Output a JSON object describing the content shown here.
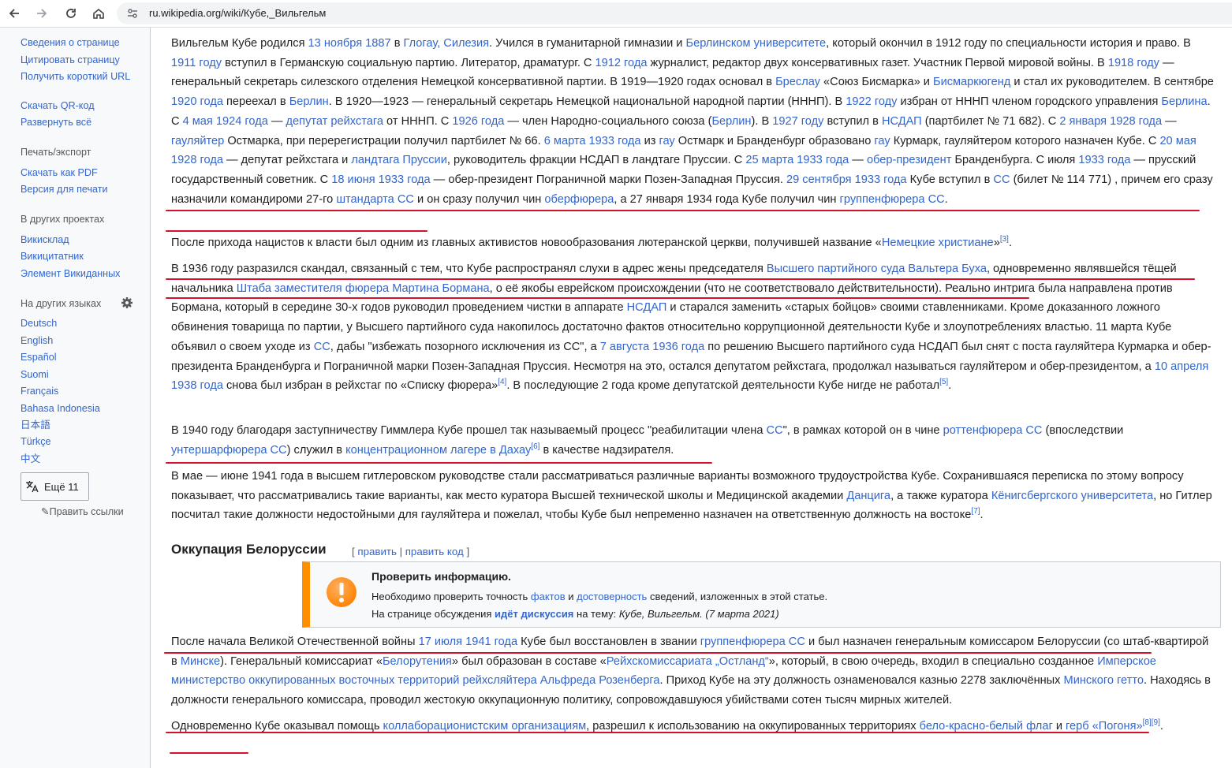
{
  "browser": {
    "url": "ru.wikipedia.org/wiki/Кубе,_Вильгельм"
  },
  "sidebar": {
    "tools": [
      "Сведения о странице",
      "Цитировать страницу",
      "Получить короткий URL",
      "Скачать QR-код",
      "Развернуть всё"
    ],
    "print_heading": "Печать/экспорт",
    "print_items": [
      "Скачать как PDF",
      "Версия для печати"
    ],
    "projects_heading": "В других проектах",
    "projects_items": [
      "Викисклад",
      "Викицитатник",
      "Элемент Викиданных"
    ],
    "languages_heading": "На других языках",
    "languages": [
      "Deutsch",
      "English",
      "Español",
      "Suomi",
      "Français",
      "Bahasa Indonesia",
      "日本語",
      "Türkçe",
      "中文"
    ],
    "more_label": "Ещё 11",
    "edit_links": "Править ссылки"
  },
  "article": {
    "p1": [
      {
        "t": "Вильгельм Кубе родился "
      },
      {
        "t": "13 ноября 1887",
        "l": 1
      },
      {
        "t": " в "
      },
      {
        "t": "Глогау, Силезия",
        "l": 1
      },
      {
        "t": ". Учился в гуманитарной гимназии и "
      },
      {
        "t": "Берлинском университете",
        "l": 1
      },
      {
        "t": ", который окончил в 1912 году по специальности история и право. В "
      },
      {
        "t": "1911 году",
        "l": 1
      },
      {
        "t": " вступил в Германскую социальную партию. Литератор, драматург. С "
      },
      {
        "t": "1912 года",
        "l": 1
      },
      {
        "t": " журналист, редактор двух консервативных газет. Участник Первой мировой войны. В "
      },
      {
        "t": "1918 году",
        "l": 1
      },
      {
        "t": " — генеральный секретарь силезского отделения Немецкой консервативной партии. В 1919—1920 годах основал в "
      },
      {
        "t": "Бреслау",
        "l": 1
      },
      {
        "t": " «Союз Бисмарка» и "
      },
      {
        "t": "Бисмаркюгенд",
        "l": 1
      },
      {
        "t": " и стал их руководителем. В сентябре "
      },
      {
        "t": "1920 года",
        "l": 1
      },
      {
        "t": " переехал в "
      },
      {
        "t": "Берлин",
        "l": 1
      },
      {
        "t": ". В 1920—1923 — генеральный секретарь Немецкой национальной народной партии (НННП). В "
      },
      {
        "t": "1922 году",
        "l": 1
      },
      {
        "t": " избран от НННП членом городского управления "
      },
      {
        "t": "Берлина",
        "l": 1
      },
      {
        "t": ". С "
      },
      {
        "t": "4 мая 1924 года",
        "l": 1
      },
      {
        "t": " — "
      },
      {
        "t": "депутат рейхстага",
        "l": 1
      },
      {
        "t": " от НННП. С "
      },
      {
        "t": "1926 года",
        "l": 1
      },
      {
        "t": " — член Народно-социального союза ("
      },
      {
        "t": "Берлин",
        "l": 1
      },
      {
        "t": "). В "
      },
      {
        "t": "1927 году",
        "l": 1
      },
      {
        "t": " вступил в "
      },
      {
        "t": "НСДАП",
        "l": 1
      },
      {
        "t": " (партбилет № 71 682). С "
      },
      {
        "t": "2 января 1928 года",
        "l": 1
      },
      {
        "t": " — "
      },
      {
        "t": "гауляйтер",
        "l": 1
      },
      {
        "t": " Остмарка, при перерегистрации получил партбилет № 66. "
      },
      {
        "t": "6 марта 1933 года",
        "l": 1
      },
      {
        "t": " из "
      },
      {
        "t": "гау",
        "l": 1
      },
      {
        "t": " Остмарк и Бранденбург образовано "
      },
      {
        "t": "гау",
        "l": 1
      },
      {
        "t": " Курмарк, гауляйтером которого назначен Кубе. С "
      },
      {
        "t": "20 мая 1928 года",
        "l": 1
      },
      {
        "t": " — депутат рейхстага и "
      },
      {
        "t": "ландтага Пруссии",
        "l": 1
      },
      {
        "t": ", руководитель фракции НСДАП в ландтаге Пруссии. С "
      },
      {
        "t": "25 марта 1933 года",
        "l": 1
      },
      {
        "t": " — "
      },
      {
        "t": "обер-президент",
        "l": 1
      },
      {
        "t": " Бранденбурга. С июля "
      },
      {
        "t": "1933 года",
        "l": 1
      },
      {
        "t": " — прусский государственный советник. С "
      },
      {
        "t": "18 июня 1933 года",
        "l": 1
      },
      {
        "t": " — обер-президент Пограничной марки Позен-Западная Пруссия. "
      },
      {
        "t": "29 сентября 1933 года",
        "l": 1
      },
      {
        "t": " Кубе вступил в "
      },
      {
        "t": "СС",
        "l": 1
      },
      {
        "t": " (билет № 114 771) , причем его сразу назначили командироми 27-го "
      },
      {
        "t": "штандарта СС",
        "l": 1
      },
      {
        "t": " и он сразу получил чин "
      },
      {
        "t": "оберфюрера",
        "l": 1
      },
      {
        "t": ", а 27 января 1934 года Кубе получил чин "
      },
      {
        "t": "группенфюрера СС",
        "l": 1
      },
      {
        "t": "."
      }
    ],
    "p2": [
      {
        "t": "После прихода нацистов к власти был одним из главных активистов новообразования лютеранской церкви, получившей название «"
      },
      {
        "t": "Немецкие христиане",
        "l": 1
      },
      {
        "t": "»"
      },
      {
        "t": "[3]",
        "s": 1
      },
      {
        "t": "."
      }
    ],
    "p3": [
      {
        "t": "В 1936 году разразился скандал, связанный с тем, что Кубе распространял слухи в адрес жены председателя "
      },
      {
        "t": "Высшего партийного суда",
        "l": 1
      },
      {
        "t": " "
      },
      {
        "t": "Вальтера Буха",
        "l": 1
      },
      {
        "t": ", одновременно являвшейся тёщей начальника "
      },
      {
        "t": "Штаба заместителя фюрера",
        "l": 1
      },
      {
        "t": " "
      },
      {
        "t": "Мартина Бормана",
        "l": 1
      },
      {
        "t": ", о её якобы еврейском происхождении (что не соответствовало действительности). Реально интрига была направлена против Бормана, который в середине 30-х годов руководил проведением чистки в аппарате "
      },
      {
        "t": "НСДАП",
        "l": 1
      },
      {
        "t": " и старался заменить «старых бойцов» своими ставленниками. Кроме доказанного ложного обвинения товарища по партии, у Высшего партийного суда накопилось достаточно фактов относительно коррупционной деятельности Кубе и злоупотреблениях властью. 11 марта Кубе объявил о своем уходе из "
      },
      {
        "t": "СС",
        "l": 1
      },
      {
        "t": ", дабы \"избежать позорного исключения из СС\", а "
      },
      {
        "t": "7 августа 1936 года",
        "l": 1
      },
      {
        "t": " по решению Высшего партийного суда НСДАП был снят с поста гауляйтера Курмарка и обер-президента Бранденбурга и Пограничной марки Позен-Западная Пруссия. Несмотря на это, остался депутатом рейхстага, продолжал называться гауляйтером и обер-президентом, а "
      },
      {
        "t": "10 апреля 1938 года",
        "l": 1
      },
      {
        "t": " снова был избран в рейхстаг по «Списку фюрера»"
      },
      {
        "t": "[4]",
        "s": 1
      },
      {
        "t": ". В последующие 2 года кроме депутатской деятельности Кубе нигде не работал"
      },
      {
        "t": "[5]",
        "s": 1
      },
      {
        "t": "."
      }
    ],
    "p4": [
      {
        "t": "В 1940 году благодаря заступничеству Гиммлера Кубе прошел так называемый процесс \"реабилитации члена "
      },
      {
        "t": "СС",
        "l": 1
      },
      {
        "t": "\", в рамках которой он в чине "
      },
      {
        "t": "роттенфюрера СС",
        "l": 1
      },
      {
        "t": " (впоследствии "
      },
      {
        "t": "унтершарфюрера СС",
        "l": 1
      },
      {
        "t": ") служил в "
      },
      {
        "t": "концентрационном лагере в Дахау",
        "l": 1
      },
      {
        "t": "[6]",
        "s": 1
      },
      {
        "t": " в качестве надзирателя."
      }
    ],
    "p5": [
      {
        "t": "В мае — июне 1941 года в высшем гитлеровском руководстве стали рассматриваться различные варианты возможного трудоустройства Кубе. Сохранившаяся переписка по этому вопросу показывает, что рассматривались такие варианты, как место куратора Высшей технической школы и Медицинской академии "
      },
      {
        "t": "Данцига",
        "l": 1
      },
      {
        "t": ", а также куратора "
      },
      {
        "t": "Кёнигсбергского университета",
        "l": 1
      },
      {
        "t": ", но Гитлер посчитал такие должности недостойными для гауляйтера и пожелал, чтобы Кубе был непременно назначен на ответственную должность на востоке"
      },
      {
        "t": "[7]",
        "s": 1
      },
      {
        "t": "."
      }
    ],
    "section_heading": "Оккупация Белоруссии",
    "section_edit": [
      {
        "t": "[ "
      },
      {
        "t": "править",
        "l": 1
      },
      {
        "t": " | "
      },
      {
        "t": "править код",
        "l": 1
      },
      {
        "t": " ]"
      }
    ],
    "ambox": {
      "title": "Проверить информацию.",
      "line1": [
        {
          "t": "Необходимо проверить точность "
        },
        {
          "t": "фактов",
          "l": 1
        },
        {
          "t": " и "
        },
        {
          "t": "достоверность",
          "l": 1
        },
        {
          "t": " сведений, изложенных в этой статье."
        }
      ],
      "line2": [
        {
          "t": "На странице обсуждения "
        },
        {
          "t": "идёт дискуссия",
          "l": 1,
          "b": 1
        },
        {
          "t": " на тему: "
        },
        {
          "t": "Кубе, Вильгельм. (7 марта 2021)",
          "i": 1
        }
      ]
    },
    "p6": [
      {
        "t": "После начала Великой Отечественной войны "
      },
      {
        "t": "17 июля 1941 года",
        "l": 1
      },
      {
        "t": " Кубе был восстановлен в звании "
      },
      {
        "t": "группенфюрера СС",
        "l": 1
      },
      {
        "t": " и был назначен генеральным комиссаром Белоруссии (со штаб-квартирой в "
      },
      {
        "t": "Минске",
        "l": 1
      },
      {
        "t": "). Генеральный комиссариат «"
      },
      {
        "t": "Белорутения",
        "l": 1
      },
      {
        "t": "» был образован в составе «"
      },
      {
        "t": "Рейхскомиссариата „Остланд“",
        "l": 1
      },
      {
        "t": "», который, в свою очередь, входил в специально созданное "
      },
      {
        "t": "Имперское министерство оккупированных восточных территорий",
        "l": 1
      },
      {
        "t": " "
      },
      {
        "t": "рейхсляйтера",
        "l": 1
      },
      {
        "t": " "
      },
      {
        "t": "Альфреда Розенберга",
        "l": 1
      },
      {
        "t": ". Приход Кубе на эту должность ознаменовался казнью 2278 заключённых "
      },
      {
        "t": "Минского гетто",
        "l": 1
      },
      {
        "t": ". Находясь в должности генерального комиссара, проводил жестокую оккупационную политику, сопровождавшуюся убийствами сотен тысяч мирных жителей."
      }
    ],
    "p7": [
      {
        "t": "Одновременно Кубе оказывал помощь "
      },
      {
        "t": "коллаборационистским организациям",
        "l": 1
      },
      {
        "t": ", разрешил к использованию на оккупированных территориях "
      },
      {
        "t": "бело-красно-белый флаг",
        "l": 1
      },
      {
        "t": " и "
      },
      {
        "t": "герб «Погоня»",
        "l": 1
      },
      {
        "t": "[8]",
        "s": 1
      },
      {
        "t": "[9]",
        "s": 1
      },
      {
        "t": "."
      }
    ]
  },
  "colors": {
    "link": "#3366cc",
    "text": "#202122",
    "annotation_red": "#d4102a",
    "ambox_orange": "#ff8f00",
    "warning_icon": "#ff8000"
  }
}
